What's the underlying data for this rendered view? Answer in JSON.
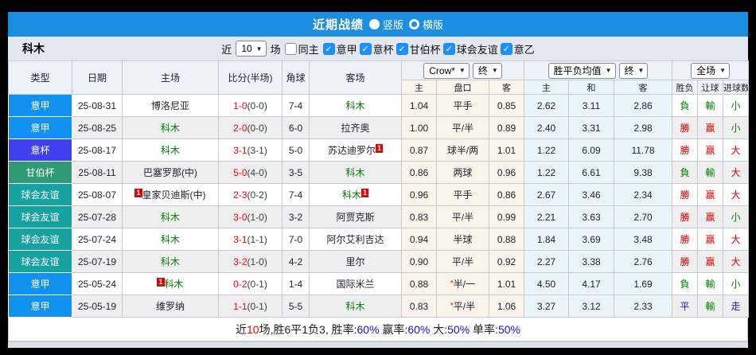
{
  "titlebar": {
    "title": "近期战绩",
    "radios": [
      {
        "label": "竖版",
        "selected": true
      },
      {
        "label": "横版",
        "selected": false
      }
    ]
  },
  "filter": {
    "team": "科木",
    "near_label": "近",
    "count_value": "10",
    "games_label": "场",
    "same_home_label": "同主",
    "same_home_checked": false,
    "leagues": [
      {
        "label": "意甲",
        "checked": true
      },
      {
        "label": "意杯",
        "checked": true
      },
      {
        "label": "甘伯杯",
        "checked": true
      },
      {
        "label": "球会友谊",
        "checked": true
      },
      {
        "label": "意乙",
        "checked": true
      }
    ]
  },
  "dropdowns": {
    "bookmaker": "Crow*",
    "asian_time": "终",
    "euro_avg": "胜平负均值",
    "euro_time": "终",
    "scope": "全场"
  },
  "table": {
    "headers_left": [
      "类型",
      "日期",
      "主场",
      "比分(半场)",
      "角球",
      "客场"
    ],
    "sub_headers": [
      "主",
      "盘口",
      "客",
      "主",
      "和",
      "客",
      "胜负",
      "让球",
      "进球数"
    ]
  },
  "colors": {
    "serie_a": "#1292f0",
    "italy_cup": "#4040f0",
    "gamper_cup": "#2f9a74",
    "friendly": "#16a2a0",
    "topbar_blue": "#1b8ee2",
    "win_red": "#e60000",
    "lose_green": "#008000",
    "draw_blue": "#1414e6"
  },
  "rows": [
    {
      "league": "意甲",
      "league_color": "#1292f0",
      "date": "25-08-31",
      "home": "博洛尼亚",
      "home_green": false,
      "home_badge": "",
      "score": "1-0",
      "half": "(0-0)",
      "corners": "7-4",
      "away": "科木",
      "away_green": true,
      "away_badge": "",
      "asian": {
        "home": "1.04",
        "line": "平手",
        "away": "0.85",
        "star": false
      },
      "euro": {
        "home": "2.62",
        "draw": "3.11",
        "away": "2.86"
      },
      "results": [
        {
          "text": "負",
          "color": "g"
        },
        {
          "text": "輸",
          "color": "g"
        },
        {
          "text": "小",
          "color": "g"
        }
      ]
    },
    {
      "league": "意甲",
      "league_color": "#1292f0",
      "date": "25-08-25",
      "home": "科木",
      "home_green": true,
      "home_badge": "",
      "score": "2-0",
      "half": "(0-0)",
      "corners": "6-0",
      "away": "拉齐奥",
      "away_green": false,
      "away_badge": "",
      "asian": {
        "home": "1.00",
        "line": "平/半",
        "away": "0.89",
        "star": false
      },
      "euro": {
        "home": "2.40",
        "draw": "3.31",
        "away": "2.98"
      },
      "results": [
        {
          "text": "勝",
          "color": "r"
        },
        {
          "text": "赢",
          "color": "r"
        },
        {
          "text": "小",
          "color": "g"
        }
      ]
    },
    {
      "league": "意杯",
      "league_color": "#4040f0",
      "date": "25-08-17",
      "home": "科木",
      "home_green": true,
      "home_badge": "",
      "score": "3-1",
      "half": "(3-1)",
      "corners": "5-0",
      "away": "苏达迪罗尔",
      "away_green": false,
      "away_badge": "1",
      "asian": {
        "home": "0.87",
        "line": "球半/两",
        "away": "1.01",
        "star": false
      },
      "euro": {
        "home": "1.22",
        "draw": "6.09",
        "away": "11.78"
      },
      "results": [
        {
          "text": "勝",
          "color": "r"
        },
        {
          "text": "赢",
          "color": "r"
        },
        {
          "text": "大",
          "color": "r"
        }
      ]
    },
    {
      "league": "甘伯杯",
      "league_color": "#2f9a74",
      "date": "25-08-11",
      "home": "巴塞罗那(中)",
      "home_green": false,
      "home_badge": "",
      "score": "5-0",
      "half": "(4-0)",
      "corners": "3-5",
      "away": "科木",
      "away_green": true,
      "away_badge": "",
      "asian": {
        "home": "0.86",
        "line": "两球",
        "away": "0.96",
        "star": false
      },
      "euro": {
        "home": "1.22",
        "draw": "6.61",
        "away": "9.38"
      },
      "results": [
        {
          "text": "負",
          "color": "g"
        },
        {
          "text": "輸",
          "color": "g"
        },
        {
          "text": "大",
          "color": "r"
        }
      ]
    },
    {
      "league": "球会友谊",
      "league_color": "#16a2a0",
      "date": "25-08-07",
      "home": "皇家贝迪斯(中)",
      "home_green": false,
      "home_badge": "1",
      "score": "2-3",
      "half": "(0-2)",
      "corners": "7-4",
      "away": "科木",
      "away_green": true,
      "away_badge": "1",
      "asian": {
        "home": "0.96",
        "line": "平手",
        "away": "0.86",
        "star": false
      },
      "euro": {
        "home": "2.67",
        "draw": "3.46",
        "away": "2.34"
      },
      "results": [
        {
          "text": "勝",
          "color": "r"
        },
        {
          "text": "赢",
          "color": "r"
        },
        {
          "text": "大",
          "color": "r"
        }
      ]
    },
    {
      "league": "球会友谊",
      "league_color": "#16a2a0",
      "date": "25-07-28",
      "home": "科木",
      "home_green": true,
      "home_badge": "",
      "score": "3-0",
      "half": "(1-0)",
      "corners": "3-2",
      "away": "阿贾克斯",
      "away_green": false,
      "away_badge": "",
      "asian": {
        "home": "0.83",
        "line": "平/半",
        "away": "0.99",
        "star": false
      },
      "euro": {
        "home": "2.21",
        "draw": "3.63",
        "away": "2.70"
      },
      "results": [
        {
          "text": "勝",
          "color": "r"
        },
        {
          "text": "赢",
          "color": "r"
        },
        {
          "text": "小",
          "color": "g"
        }
      ]
    },
    {
      "league": "球会友谊",
      "league_color": "#16a2a0",
      "date": "25-07-24",
      "home": "科木",
      "home_green": true,
      "home_badge": "",
      "score": "3-1",
      "half": "(1-1)",
      "corners": "7-0",
      "away": "阿尔艾利吉达",
      "away_green": false,
      "away_badge": "",
      "asian": {
        "home": "0.94",
        "line": "半球",
        "away": "0.88",
        "star": false
      },
      "euro": {
        "home": "1.84",
        "draw": "3.69",
        "away": "3.48"
      },
      "results": [
        {
          "text": "勝",
          "color": "r"
        },
        {
          "text": "赢",
          "color": "r"
        },
        {
          "text": "大",
          "color": "r"
        }
      ]
    },
    {
      "league": "球会友谊",
      "league_color": "#16a2a0",
      "date": "25-07-19",
      "home": "科木",
      "home_green": true,
      "home_badge": "",
      "score": "3-2",
      "half": "(1-0)",
      "corners": "4-2",
      "away": "里尔",
      "away_green": false,
      "away_badge": "",
      "asian": {
        "home": "0.90",
        "line": "平/半",
        "away": "0.92",
        "star": false
      },
      "euro": {
        "home": "2.27",
        "draw": "3.38",
        "away": "2.76"
      },
      "results": [
        {
          "text": "勝",
          "color": "r"
        },
        {
          "text": "赢",
          "color": "r"
        },
        {
          "text": "大",
          "color": "r"
        }
      ]
    },
    {
      "league": "意甲",
      "league_color": "#1292f0",
      "date": "25-05-24",
      "home": "科木",
      "home_green": true,
      "home_badge": "1",
      "score": "0-2",
      "half": "(0-1)",
      "corners": "1-4",
      "away": "国际米兰",
      "away_green": false,
      "away_badge": "",
      "asian": {
        "home": "0.88",
        "line": "半/一",
        "away": "1.01",
        "star": true
      },
      "euro": {
        "home": "4.50",
        "draw": "4.17",
        "away": "1.69"
      },
      "results": [
        {
          "text": "負",
          "color": "g"
        },
        {
          "text": "輸",
          "color": "g"
        },
        {
          "text": "小",
          "color": "g"
        }
      ]
    },
    {
      "league": "意甲",
      "league_color": "#1292f0",
      "date": "25-05-19",
      "home": "维罗纳",
      "home_green": false,
      "home_badge": "",
      "score": "1-1",
      "half": "(0-1)",
      "corners": "5-5",
      "away": "科木",
      "away_green": true,
      "away_badge": "",
      "asian": {
        "home": "0.83",
        "line": "平/半",
        "away": "1.06",
        "star": true
      },
      "euro": {
        "home": "3.27",
        "draw": "3.12",
        "away": "2.33"
      },
      "results": [
        {
          "text": "平",
          "color": "b"
        },
        {
          "text": "輸",
          "color": "g"
        },
        {
          "text": "走",
          "color": "b"
        }
      ]
    }
  ],
  "summary": [
    {
      "text": "近",
      "color": "#222222"
    },
    {
      "text": "10",
      "color": "#ff0000"
    },
    {
      "text": "场,胜6平1负3, 胜率:",
      "color": "#222222"
    },
    {
      "text": "60%",
      "color": "#1414e6"
    },
    {
      "text": " 赢率:",
      "color": "#222222"
    },
    {
      "text": "60%",
      "color": "#1414e6"
    },
    {
      "text": " 大:",
      "color": "#222222"
    },
    {
      "text": "50%",
      "color": "#1414e6"
    },
    {
      "text": " 单率:",
      "color": "#222222"
    },
    {
      "text": "50%",
      "color": "#1414e6"
    }
  ]
}
